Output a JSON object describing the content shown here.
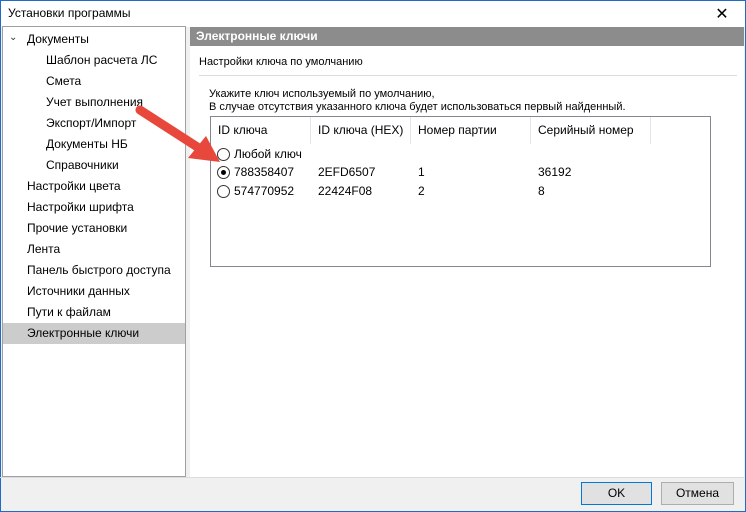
{
  "window": {
    "title": "Установки программы",
    "close_glyph": "✕"
  },
  "tree": {
    "items": [
      {
        "label": "Документы",
        "expanded": true
      },
      {
        "label": "Шаблон расчета ЛС"
      },
      {
        "label": "Смета"
      },
      {
        "label": "Учет выполнения"
      },
      {
        "label": "Экспорт/Импорт"
      },
      {
        "label": "Документы НБ"
      },
      {
        "label": "Справочники"
      },
      {
        "label": "Настройки цвета"
      },
      {
        "label": "Настройки шрифта"
      },
      {
        "label": "Прочие установки"
      },
      {
        "label": "Лента"
      },
      {
        "label": "Панель быстрого доступа"
      },
      {
        "label": "Источники данных"
      },
      {
        "label": "Пути к файлам"
      },
      {
        "label": "Электронные ключи",
        "selected": true
      }
    ],
    "expander_glyph": "⌄"
  },
  "panel": {
    "header": "Электронные ключи",
    "group_label": "Настройки ключа по умолчанию",
    "desc_line1": "Укажите ключ используемый по умолчанию,",
    "desc_line2": "В случае отсутствия указанного ключа будет использоваться первый найденный."
  },
  "keys_table": {
    "columns": [
      "ID ключа",
      "ID ключа (HEX)",
      "Номер партии",
      "Серийный номер"
    ],
    "rows": [
      {
        "id": "Любой ключ",
        "hex": "",
        "batch": "",
        "serial": "",
        "checked": false
      },
      {
        "id": "788358407",
        "hex": "2EFD6507",
        "batch": "1",
        "serial": "36192",
        "checked": true
      },
      {
        "id": "574770952",
        "hex": "22424F08",
        "batch": "2",
        "serial": "8",
        "checked": false
      }
    ]
  },
  "buttons": {
    "ok": "OK",
    "cancel": "Отмена"
  },
  "colors": {
    "annotation_arrow": "#e8473b",
    "panel_header_bg": "#8c8c8c",
    "selection_bg": "#cccccc"
  }
}
